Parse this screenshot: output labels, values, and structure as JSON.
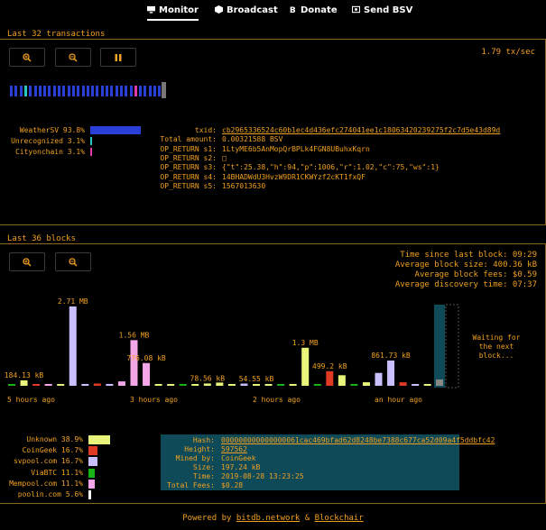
{
  "nav": {
    "items": [
      {
        "label": "Monitor",
        "icon": "monitor-icon",
        "active": true
      },
      {
        "label": "Broadcast",
        "icon": "cube-icon",
        "active": false
      },
      {
        "label": "Donate",
        "icon": "bitcoin-icon",
        "active": false
      },
      {
        "label": "Send BSV",
        "icon": "send-icon",
        "active": false
      }
    ]
  },
  "transactions": {
    "title": "Last 32 transactions",
    "rate": "1.79 tx/sec",
    "legend": [
      {
        "name": "WeatherSV",
        "pct": "93.8%",
        "fraction": 0.938,
        "color": "#2a3ed8"
      },
      {
        "name": "Unrecognized",
        "pct": "3.1%",
        "fraction": 0.031,
        "color": "#27c7c0"
      },
      {
        "name": "Cityonchain",
        "pct": "3.1%",
        "fraction": 0.031,
        "color": "#e03aa8"
      }
    ],
    "details": [
      {
        "key": "txid:",
        "value": "cb2965336524c60b1ec4d436efc274041ee1c18063420239275f2c7d5e43d89d",
        "link": true
      },
      {
        "key": "Total amount:",
        "value": "0.00321588 BSV",
        "link": false
      },
      {
        "key": "OP_RETURN s1:",
        "value": "1LtyME6b5AnMopQrBPLk4FGN8UBuhxKqrn",
        "link": false
      },
      {
        "key": "OP_RETURN s2:",
        "value": "□",
        "link": false
      },
      {
        "key": "OP_RETURN s3:",
        "value": "{\"t\":25.38,\"h\":94,\"p\":1006,\"r\":1.02,\"c\":75,\"ws\":1}",
        "link": false
      },
      {
        "key": "OP_RETURN s4:",
        "value": "14BHADWdU3HvzW9DR1CKWYzf2cKT1fxQF",
        "link": false
      },
      {
        "key": "OP_RETURN s5:",
        "value": "1567013630",
        "link": false
      }
    ]
  },
  "blocks": {
    "title": "Last 36 blocks",
    "stats": [
      "Time since last block: 09:29",
      "Average block size: 400.36 kB",
      "Average block fees: $0.59",
      "Average discovery time: 07:37"
    ],
    "waiting": "Waiting for\nthe next\nblock...",
    "x_ticks": [
      "5 hours ago",
      "3 hours ago",
      "2 hours ago",
      "an hour ago"
    ],
    "chart_data": {
      "type": "bar",
      "ylabel": "",
      "xlabel": "",
      "values_kb": [
        4,
        184.13,
        52,
        12,
        40,
        2710,
        60,
        76,
        62,
        150,
        1560,
        776.08,
        6,
        4,
        2,
        60,
        78.56,
        110,
        12,
        75,
        54.55,
        42,
        2,
        28,
        1300,
        60,
        499.2,
        360,
        20,
        120,
        440,
        861.73,
        120,
        30,
        14,
        4
      ],
      "colors": [
        "#17b317",
        "#e8f47a",
        "#e03a25",
        "#f4a6e8",
        "#e8f47a",
        "#c8c0ff",
        "#c8c0ff",
        "#e03a25",
        "#c8c0ff",
        "#f4a6e8",
        "#f4a6e8",
        "#f4a6e8",
        "#e8f47a",
        "#e8f47a",
        "#17b317",
        "#e8f47a",
        "#e8f47a",
        "#e8f47a",
        "#e8f47a",
        "#c8c0ff",
        "#e8f47a",
        "#e8f47a",
        "#17b317",
        "#e8f47a",
        "#e8f47a",
        "#17b317",
        "#e03a25",
        "#e8f47a",
        "#17b317",
        "#e8f47a",
        "#c8c0ff",
        "#c8c0ff",
        "#e03a25",
        "#c8c0ff",
        "#e8f47a",
        "#17b317"
      ],
      "data_labels": {
        "1": "184.13 kB",
        "5": "2.71 MB",
        "10": "1.56 MB",
        "11": "776.08 kB",
        "16": "78.56 kB",
        "20": "54.55 kB",
        "24": "1.3 MB",
        "26": "499.2 kB",
        "31": "861.73 kB"
      }
    },
    "miners": [
      {
        "name": "Unknown",
        "pct": "38.9%",
        "fraction": 0.389,
        "color": "#e8f47a"
      },
      {
        "name": "CoinGeek",
        "pct": "16.7%",
        "fraction": 0.167,
        "color": "#e03a25"
      },
      {
        "name": "svpool.com",
        "pct": "16.7%",
        "fraction": 0.167,
        "color": "#c8c0ff"
      },
      {
        "name": "ViaBTC",
        "pct": "11.1%",
        "fraction": 0.111,
        "color": "#17b317"
      },
      {
        "name": "Mempool.com",
        "pct": "11.1%",
        "fraction": 0.111,
        "color": "#f4a6e8"
      },
      {
        "name": "poolin.com",
        "pct": "5.6%",
        "fraction": 0.056,
        "color": "#ffffff"
      }
    ],
    "info": [
      {
        "key": "Hash:",
        "value": "000000000000000061cac469bfad62d8248be7388c677ca52d09a4f5ddbfc42",
        "link": true
      },
      {
        "key": "Height:",
        "value": "597562",
        "link": true
      },
      {
        "key": "Mined by:",
        "value": "CoinGeek",
        "link": false
      },
      {
        "key": "Size:",
        "value": "197.24 kB",
        "link": false
      },
      {
        "key": "Time:",
        "value": "2019-08-28 13:23:25",
        "link": false
      },
      {
        "key": "Total Fees:",
        "value": "$0.28",
        "link": false
      }
    ]
  },
  "footer": {
    "prefix": "Powered by ",
    "link1": "bitdb.network",
    "sep": " & ",
    "link2": "Blockchair"
  }
}
